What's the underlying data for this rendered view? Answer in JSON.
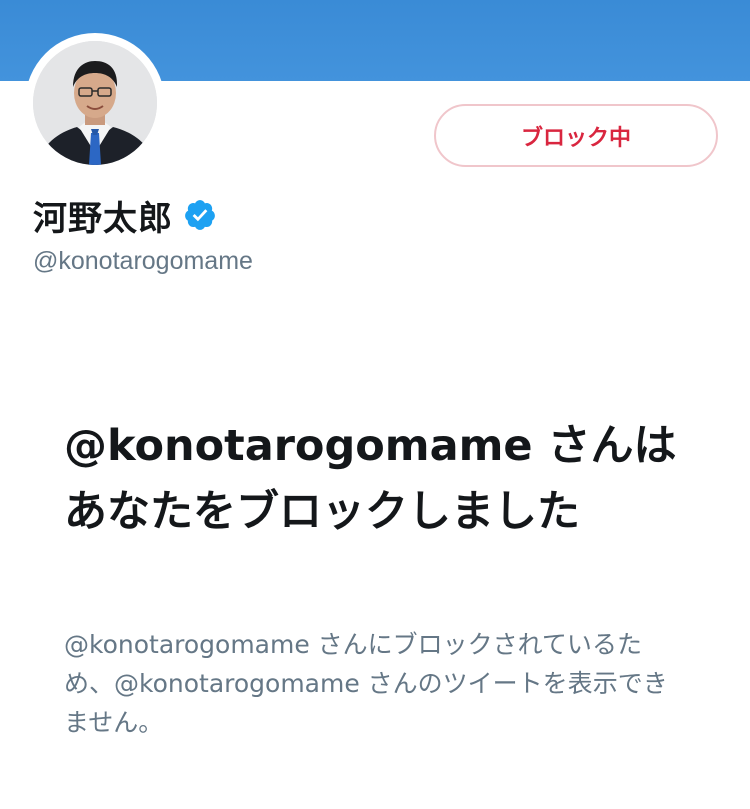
{
  "header": {
    "banner_color": "#3d8ed8"
  },
  "profile": {
    "display_name": "河野太郎",
    "handle": "@konotarogomame",
    "verified": true,
    "verified_icon": "verified-badge-icon",
    "verified_color": "#1da1f2",
    "avatar_icon": "profile-avatar"
  },
  "actions": {
    "blocked_label": "ブロック中",
    "blocked_color": "#e0245e"
  },
  "block_notice": {
    "title": "@konotarogomame さんはあなたをブロックしました",
    "description": "@konotarogomame さんにブロックされているため、@konotarogomame さんのツイートを表示できません。"
  }
}
